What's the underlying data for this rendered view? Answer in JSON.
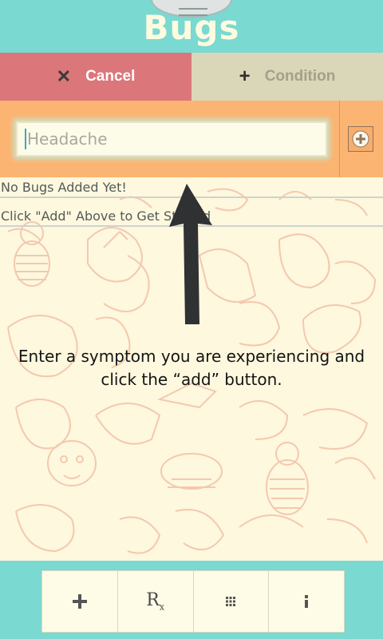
{
  "header": {
    "title": "Bugs"
  },
  "actions": {
    "cancel_label": "Cancel",
    "cancel_icon": "close-icon",
    "condition_label": "Condition",
    "condition_icon": "plus-icon"
  },
  "symptom_input": {
    "placeholder": "Headache",
    "value": ""
  },
  "add_button": {
    "icon": "plus-circle-icon"
  },
  "list": {
    "items": [
      "No Bugs Added Yet!",
      "Click \"Add\" Above to Get Started"
    ]
  },
  "hint": {
    "text": "Enter a symptom you are experiencing and click the “add” button."
  },
  "toolbar": {
    "items": [
      {
        "icon": "plus-icon"
      },
      {
        "icon": "prescription-icon",
        "text": "R"
      },
      {
        "icon": "grid-icon"
      },
      {
        "icon": "info-icon"
      }
    ]
  },
  "colors": {
    "header_bg": "#7ad9d0",
    "cancel_bg": "#db767a",
    "condition_bg": "#dad6b8",
    "input_row_bg": "#fbb472",
    "background": "#fdf8de",
    "doodle_stroke": "#f2b9a0"
  }
}
